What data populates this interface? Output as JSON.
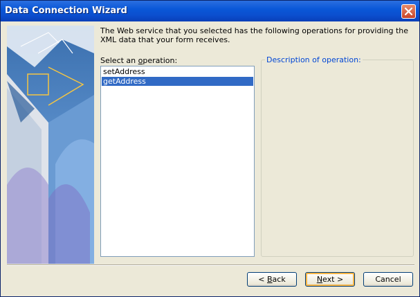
{
  "window": {
    "title": "Data Connection Wizard",
    "close_icon": "close-icon"
  },
  "main": {
    "intro_text": "The Web service that you selected has the following operations for providing the XML data that your form receives.",
    "select_label_prefix": "Select an ",
    "select_label_mnemonic": "o",
    "select_label_suffix": "peration:",
    "operations": [
      {
        "label": "setAddress",
        "selected": false
      },
      {
        "label": "getAddress",
        "selected": true
      }
    ],
    "description_legend": "Description of operation:",
    "description_text": ""
  },
  "buttons": {
    "back_prefix": "< ",
    "back_mnemonic": "B",
    "back_suffix": "ack",
    "next_mnemonic": "N",
    "next_suffix": "ext >",
    "cancel_label": "Cancel"
  },
  "colors": {
    "title_bar": "#0a58d8",
    "selection": "#316ac5",
    "legend": "#0046d5",
    "dialog_bg": "#ece9d8"
  }
}
